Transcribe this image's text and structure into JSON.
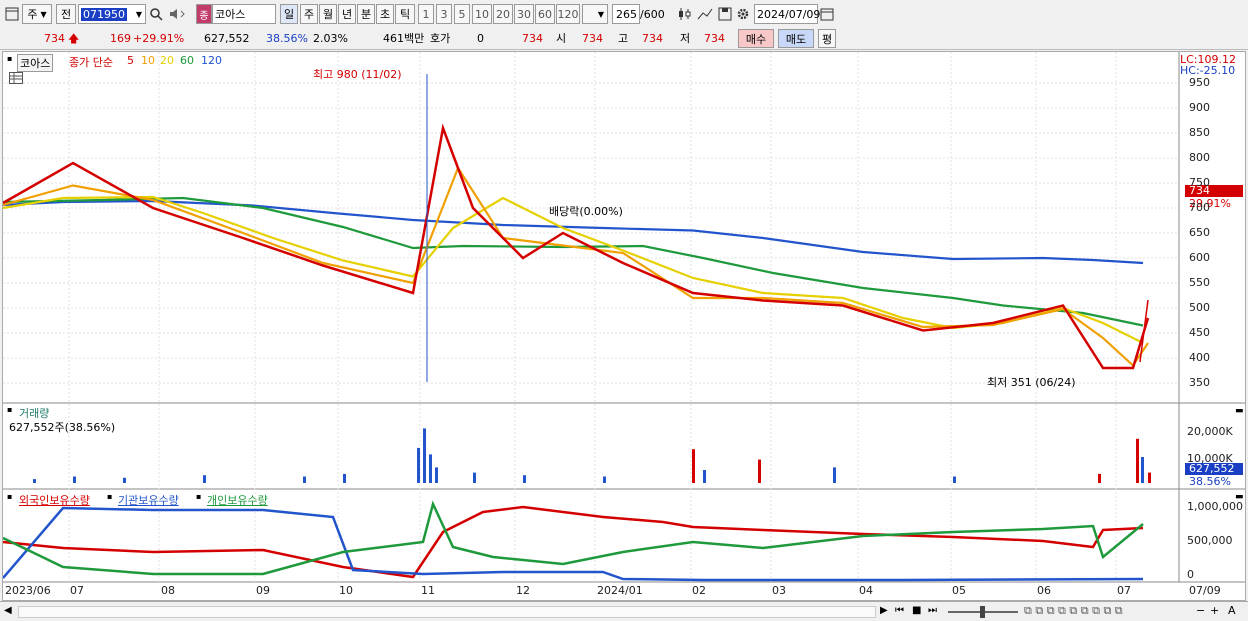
{
  "toolbar": {
    "type_select": "주",
    "prefix": "전",
    "code": "071950",
    "stock_badge": "종",
    "stock_name": "코아스",
    "periods": [
      "일",
      "주",
      "월",
      "년",
      "분",
      "초",
      "틱"
    ],
    "intervals": [
      "1",
      "3",
      "5",
      "10",
      "20",
      "30",
      "60",
      "120"
    ],
    "count": "265",
    "count_total": "/600",
    "date": "2024/07/09"
  },
  "quote": {
    "price": "734",
    "change": "169",
    "change_pct": "+29.91%",
    "volume": "627,552",
    "volume_ratio": "38.56%",
    "turnover": "2.03%",
    "amount": "461백만",
    "bid_label": "호가",
    "bid_value": "0",
    "bid_price": "734",
    "open_label": "시",
    "open": "734",
    "high_label": "고",
    "high": "734",
    "low_label": "저",
    "low": "734",
    "buy_label": "매수",
    "sell_label": "매도",
    "eval_label": "평"
  },
  "price_panel": {
    "stock_tag": "코아스",
    "ma_title": "종가 단순",
    "ma_periods": [
      {
        "label": "5",
        "color": "#d40000"
      },
      {
        "label": "10",
        "color": "#f0a000"
      },
      {
        "label": "20",
        "color": "#e6d000"
      },
      {
        "label": "60",
        "color": "#1e9a3c"
      },
      {
        "label": "120",
        "color": "#2255cc"
      }
    ],
    "lc": "LC:109.12",
    "hc": "HC:-25.10",
    "current_price": "734",
    "current_pct": "29.91%",
    "high_note": "최고 980 (11/02)",
    "dividend_note": "배당락(0.00%)",
    "low_note": "최저 351 (06/24)",
    "y_ticks": [
      "950",
      "900",
      "850",
      "800",
      "750",
      "700",
      "650",
      "600",
      "550",
      "500",
      "450",
      "400",
      "350"
    ]
  },
  "volume_panel": {
    "title": "거래량",
    "value_note": "627,552주(38.56%)",
    "y_ticks": [
      "20,000K",
      "10,000K"
    ],
    "current_value": "627,552",
    "current_pct": "38.56%"
  },
  "holder_panel": {
    "legend": [
      {
        "label": "외국인보유수량",
        "color": "#d40000"
      },
      {
        "label": "기관보유수량",
        "color": "#2255cc"
      },
      {
        "label": "개인보유수량",
        "color": "#1e9a3c"
      }
    ],
    "y_ticks": [
      "1,000,000",
      "500,000",
      "0"
    ]
  },
  "x_axis": [
    "2023/06",
    "07",
    "08",
    "09",
    "10",
    "11",
    "12",
    "2024/01",
    "02",
    "03",
    "04",
    "05",
    "06",
    "07",
    "07/09"
  ],
  "colors": {
    "up": "#d40000",
    "down": "#1a3fc4",
    "ma5": "#d40000",
    "ma10": "#f0a000",
    "ma20": "#e6d000",
    "ma60": "#1e9a3c",
    "ma120": "#2255cc"
  }
}
